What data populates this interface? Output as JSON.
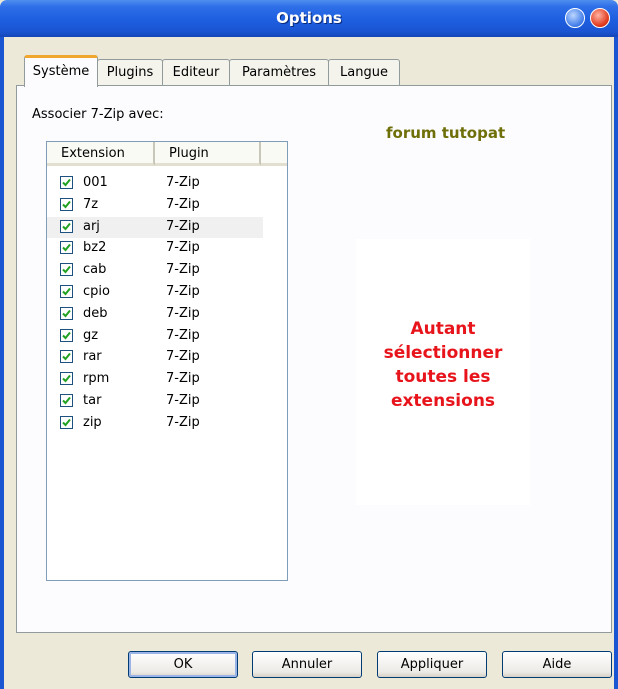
{
  "window": {
    "title": "Options"
  },
  "tabs": [
    {
      "label": "Système",
      "active": true
    },
    {
      "label": "Plugins",
      "active": false
    },
    {
      "label": "Editeur",
      "active": false
    },
    {
      "label": "Paramètres",
      "active": false
    },
    {
      "label": "Langue",
      "active": false
    }
  ],
  "systeme": {
    "associate_label": "Associer 7-Zip avec:",
    "columns": {
      "extension": "Extension",
      "plugin": "Plugin"
    },
    "rows": [
      {
        "ext": "001",
        "plugin": "7-Zip",
        "checked": true
      },
      {
        "ext": "7z",
        "plugin": "7-Zip",
        "checked": true
      },
      {
        "ext": "arj",
        "plugin": "7-Zip",
        "checked": true
      },
      {
        "ext": "bz2",
        "plugin": "7-Zip",
        "checked": true
      },
      {
        "ext": "cab",
        "plugin": "7-Zip",
        "checked": true
      },
      {
        "ext": "cpio",
        "plugin": "7-Zip",
        "checked": true
      },
      {
        "ext": "deb",
        "plugin": "7-Zip",
        "checked": true
      },
      {
        "ext": "gz",
        "plugin": "7-Zip",
        "checked": true
      },
      {
        "ext": "rar",
        "plugin": "7-Zip",
        "checked": true
      },
      {
        "ext": "rpm",
        "plugin": "7-Zip",
        "checked": true
      },
      {
        "ext": "tar",
        "plugin": "7-Zip",
        "checked": true
      },
      {
        "ext": "zip",
        "plugin": "7-Zip",
        "checked": true
      }
    ]
  },
  "annotations": {
    "brand": "forum tutopat",
    "note_lines": [
      "Autant",
      "sélectionner",
      "toutes les",
      "extensions"
    ]
  },
  "buttons": {
    "ok": "OK",
    "cancel": "Annuler",
    "apply": "Appliquer",
    "help": "Aide"
  },
  "colors": {
    "title_bar": "#1d5ee0",
    "note_text": "#e8141c",
    "brand_text": "#6f6f0a",
    "tab_highlight": "#f1a62d"
  }
}
